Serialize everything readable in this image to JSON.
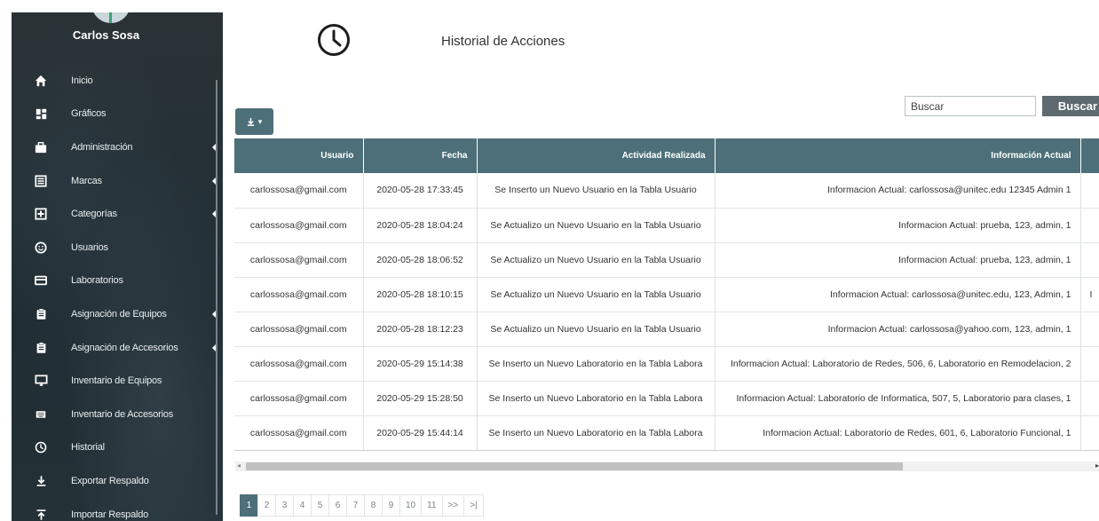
{
  "user": {
    "name": "Carlos Sosa"
  },
  "sidebar": {
    "items": [
      {
        "label": "Inicio",
        "icon": "home-icon",
        "submenu": false
      },
      {
        "label": "Gráficos",
        "icon": "dashboard-icon",
        "submenu": false
      },
      {
        "label": "Administración",
        "icon": "briefcase-icon",
        "submenu": true
      },
      {
        "label": "Marcas",
        "icon": "list-alt-icon",
        "submenu": true
      },
      {
        "label": "Categorías",
        "icon": "plus-square-icon",
        "submenu": true
      },
      {
        "label": "Usuarios",
        "icon": "smile-icon",
        "submenu": false
      },
      {
        "label": "Laboratorios",
        "icon": "credit-card-icon",
        "submenu": false
      },
      {
        "label": "Asignación de Equipos",
        "icon": "clipboard-icon",
        "submenu": true
      },
      {
        "label": "Asignación de Accesorios",
        "icon": "clipboard-icon",
        "submenu": true
      },
      {
        "label": "Inventario de Equipos",
        "icon": "desktop-icon",
        "submenu": false
      },
      {
        "label": "Inventario de Accesorios",
        "icon": "keyboard-icon",
        "submenu": false
      },
      {
        "label": "Historial",
        "icon": "clock-icon",
        "submenu": false
      },
      {
        "label": "Exportar Respaldo",
        "icon": "download-icon",
        "submenu": false
      },
      {
        "label": "Importar Respaldo",
        "icon": "upload-icon",
        "submenu": false
      }
    ]
  },
  "header": {
    "title": "Historial de Acciones",
    "icon": "clock-icon"
  },
  "toolbar": {
    "export_icon": "download-icon"
  },
  "search": {
    "placeholder": "Buscar",
    "button_label": "Buscar"
  },
  "table": {
    "columns": [
      "Usuario",
      "Fecha",
      "Actividad Realizada",
      "Información Actual",
      ""
    ],
    "rows": [
      [
        "carlossosa@gmail.com",
        "2020-05-28 17:33:45",
        "Se Inserto un Nuevo Usuario en la Tabla Usuario",
        "Informacion Actual: carlossosa@unitec.edu 12345 Admin 1",
        ""
      ],
      [
        "carlossosa@gmail.com",
        "2020-05-28 18:04:24",
        "Se Actualizo un Nuevo Usuario en la Tabla Usuario",
        "Informacion Actual: prueba, 123, admin, 1",
        ""
      ],
      [
        "carlossosa@gmail.com",
        "2020-05-28 18:06:52",
        "Se Actualizo un Nuevo Usuario en la Tabla Usuario",
        "Informacion Actual: prueba, 123, admin, 1",
        ""
      ],
      [
        "carlossosa@gmail.com",
        "2020-05-28 18:10:15",
        "Se Actualizo un Nuevo Usuario en la Tabla Usuario",
        "Informacion Actual: carlossosa@unitec.edu, 123, Admin, 1",
        "I"
      ],
      [
        "carlossosa@gmail.com",
        "2020-05-28 18:12:23",
        "Se Actualizo un Nuevo Usuario en la Tabla Usuario",
        "Informacion Actual: carlossosa@yahoo.com, 123, admin, 1",
        ""
      ],
      [
        "carlossosa@gmail.com",
        "2020-05-29 15:14:38",
        "Se Inserto un Nuevo Laboratorio en la Tabla Labora",
        "Informacion Actual: Laboratorio de Redes, 506, 6, Laboratorio en Remodelacion, 2",
        ""
      ],
      [
        "carlossosa@gmail.com",
        "2020-05-29 15:28:50",
        "Se Inserto un Nuevo Laboratorio en la Tabla Labora",
        "Informacion Actual: Laboratorio de Informatica, 507, 5, Laboratorio para clases, 1",
        ""
      ],
      [
        "carlossosa@gmail.com",
        "2020-05-29 15:44:14",
        "Se Inserto un Nuevo Laboratorio en la Tabla Labora",
        "Informacion Actual: Laboratorio de Redes, 601, 6, Laboratorio Funcional, 1",
        ""
      ]
    ]
  },
  "pagination": {
    "pages": [
      "1",
      "2",
      "3",
      "4",
      "5",
      "6",
      "7",
      "8",
      "9",
      "10",
      "11",
      ">>",
      ">|"
    ],
    "active": "1"
  },
  "colors": {
    "accent": "#4d6f79",
    "sidebar_bg": "#243036",
    "search_button": "#5d6b70"
  }
}
